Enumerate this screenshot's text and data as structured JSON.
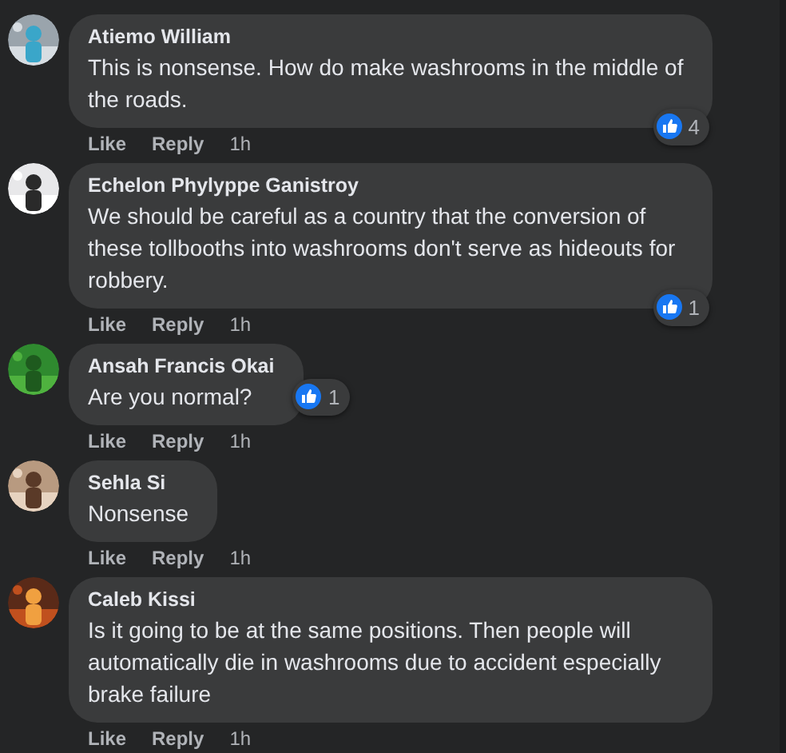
{
  "comments": [
    {
      "author": "Atiemo William",
      "text": "This is nonsense. How do make washrooms in the middle of the roads.",
      "reaction": {
        "count": "4",
        "kind": "corner"
      },
      "actions": [
        "Like",
        "Reply"
      ],
      "time": "1h"
    },
    {
      "author": "Echelon Phylyppe Ganistroy",
      "text": "We should be careful as a country that the conversion of these tollbooths into washrooms don't serve as hideouts for robbery.",
      "reaction": {
        "count": "1",
        "kind": "corner"
      },
      "actions": [
        "Like",
        "Reply"
      ],
      "time": "1h"
    },
    {
      "author": "Ansah Francis Okai",
      "text": "Are you normal?",
      "reaction": {
        "count": "1",
        "kind": "inline"
      },
      "actions": [
        "Like",
        "Reply"
      ],
      "time": "1h"
    },
    {
      "author": "Sehla Si",
      "text": "Nonsense",
      "actions": [
        "Like",
        "Reply"
      ],
      "time": "1h"
    },
    {
      "author": "Caleb Kissi",
      "text": "Is it going to be at the same positions. Then people will automatically die in washrooms due to accident especially brake failure",
      "actions": [
        "Like",
        "Reply"
      ],
      "time": "1h"
    }
  ]
}
